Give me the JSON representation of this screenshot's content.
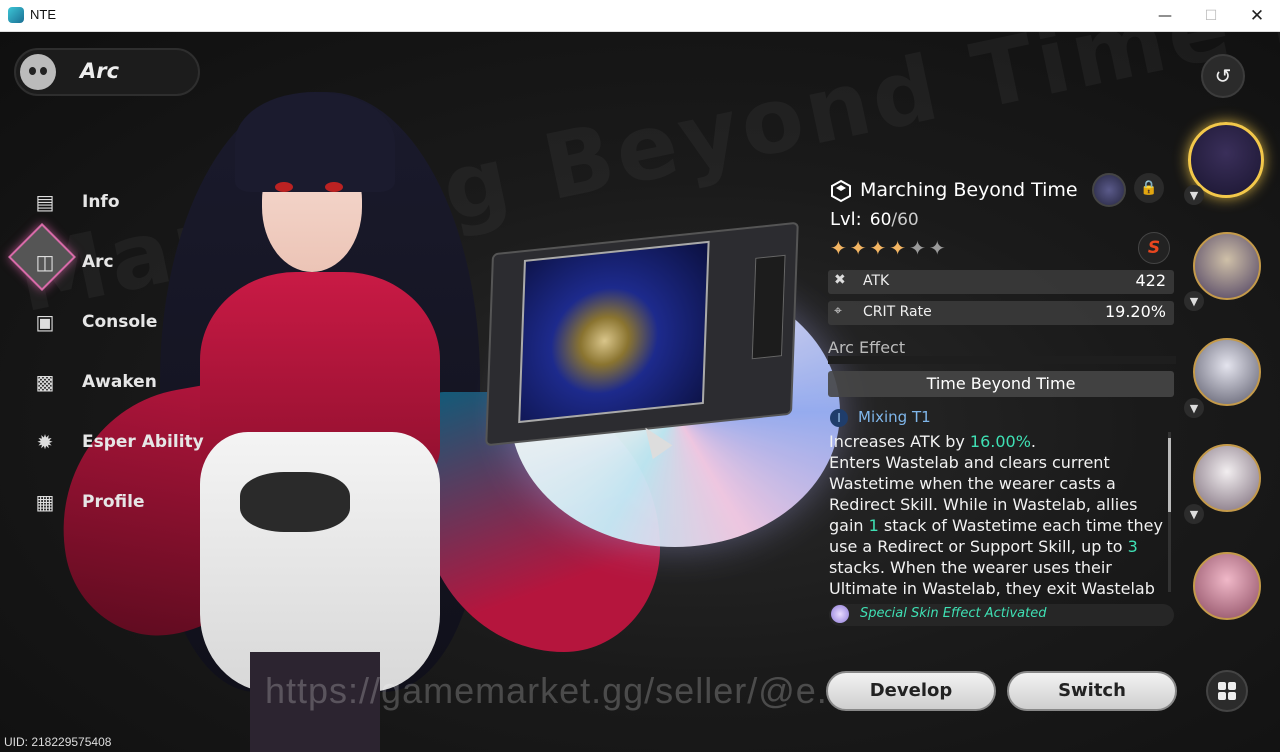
{
  "window": {
    "title": "NTE"
  },
  "game": {
    "watermark_bg": "Marching Beyond Time Evernes",
    "character_pill": {
      "label": "Arc",
      "icon": "mask-icon"
    },
    "nav": [
      {
        "label": "Info",
        "icon": "info-icon"
      },
      {
        "label": "Arc",
        "icon": "arc-icon",
        "active": true
      },
      {
        "label": "Console",
        "icon": "console-icon"
      },
      {
        "label": "Awaken",
        "icon": "awaken-icon"
      },
      {
        "label": "Esper Ability",
        "icon": "esper-icon"
      },
      {
        "label": "Profile",
        "icon": "profile-icon"
      }
    ],
    "arc": {
      "name": "Marching Beyond Time",
      "level_label": "Lvl:",
      "level_current": "60",
      "level_max": "/60",
      "stars_filled": 4,
      "stars_total": 6,
      "star_glyph": "✦",
      "rank_badge": "S",
      "stats": [
        {
          "icon": "atk-icon",
          "name": "ATK",
          "value": "422"
        },
        {
          "icon": "crit-icon",
          "name": "CRIT Rate",
          "value": "19.20%"
        }
      ],
      "effect_title": "Arc Effect",
      "effect_name": "Time Beyond Time",
      "tier_badge": "I",
      "tier_label": "Mixing T1",
      "desc": {
        "p1": "Increases ATK by ",
        "v1": "16.00%",
        "p2": ".",
        "p3": "Enters Wastelab and clears current Wastetime when the wearer casts a Redirect Skill. While in Wastelab, allies gain ",
        "v2": "1",
        "p4": " stack of Wastetime each time they use a Redirect or Support Skill, up to ",
        "v3": "3",
        "p5": " stacks. When the wearer uses their Ultimate in Wastelab, they exit Wastelab"
      },
      "special": "Special Skin Effect Activated"
    },
    "buttons": {
      "develop": "Develop",
      "switch": "Switch"
    },
    "uid": "UID: 218229575408",
    "url_watermark": "https://gamemarket.gg/seller/@e...ws"
  },
  "colors": {
    "accent": "#3fe0b4",
    "tier": "#7fb6ea",
    "star_on": "#f3b563",
    "select_gold": "#f3c84a",
    "nav_active_glow": "#d86aa8"
  }
}
